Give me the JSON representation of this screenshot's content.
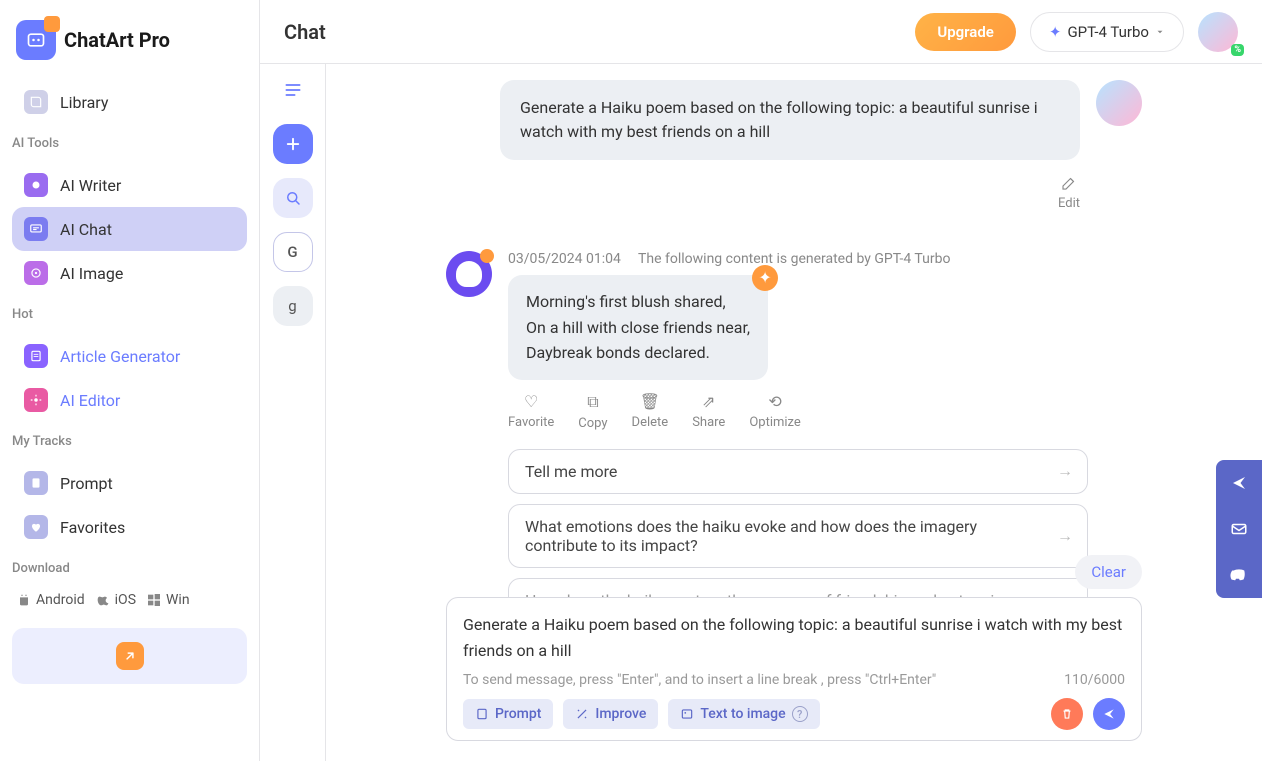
{
  "brand": "ChatArt Pro",
  "header": {
    "title": "Chat",
    "upgrade": "Upgrade",
    "model": "GPT-4 Turbo",
    "avatar_badge": "%"
  },
  "sidebar": {
    "library": "Library",
    "groups": {
      "ai_tools": "AI Tools",
      "hot": "Hot",
      "my_tracks": "My Tracks",
      "download": "Download"
    },
    "items": {
      "ai_writer": "AI Writer",
      "ai_chat": "AI Chat",
      "ai_image": "AI Image",
      "article_gen": "Article Generator",
      "ai_editor": "AI Editor",
      "prompt": "Prompt",
      "favorites": "Favorites"
    },
    "downloads": {
      "android": "Android",
      "ios": "iOS",
      "win": "Win"
    }
  },
  "mini": {
    "g_upper": "G",
    "g_lower": "g"
  },
  "chat": {
    "user_msg": "Generate a Haiku poem based on the following topic: a beautiful sunrise i watch with my best friends on a hill",
    "edit": "Edit",
    "bot_ts": "03/05/2024 01:04",
    "bot_note": "The following content is generated by GPT-4 Turbo",
    "bot_lines": [
      "Morning's first blush shared,",
      "On a hill with close friends near,",
      "Daybreak bonds declared."
    ],
    "actions": {
      "favorite": "Favorite",
      "copy": "Copy",
      "delete": "Delete",
      "share": "Share",
      "optimize": "Optimize"
    },
    "suggestions": [
      "Tell me more",
      "What emotions does the haiku evoke and how does the imagery contribute to its impact?",
      "How does the haiku capture the essence of friendship and nature in a few short lines?"
    ]
  },
  "footer": {
    "clear": "Clear",
    "input_text": "Generate a Haiku poem based on the following topic: a beautiful sunrise i watch with my best friends on a hill",
    "hint": "To send message, press \"Enter\", and to insert a line break , press \"Ctrl+Enter\"",
    "counter": "110/6000",
    "prompt": "Prompt",
    "improve": "Improve",
    "t2i": "Text to image"
  }
}
